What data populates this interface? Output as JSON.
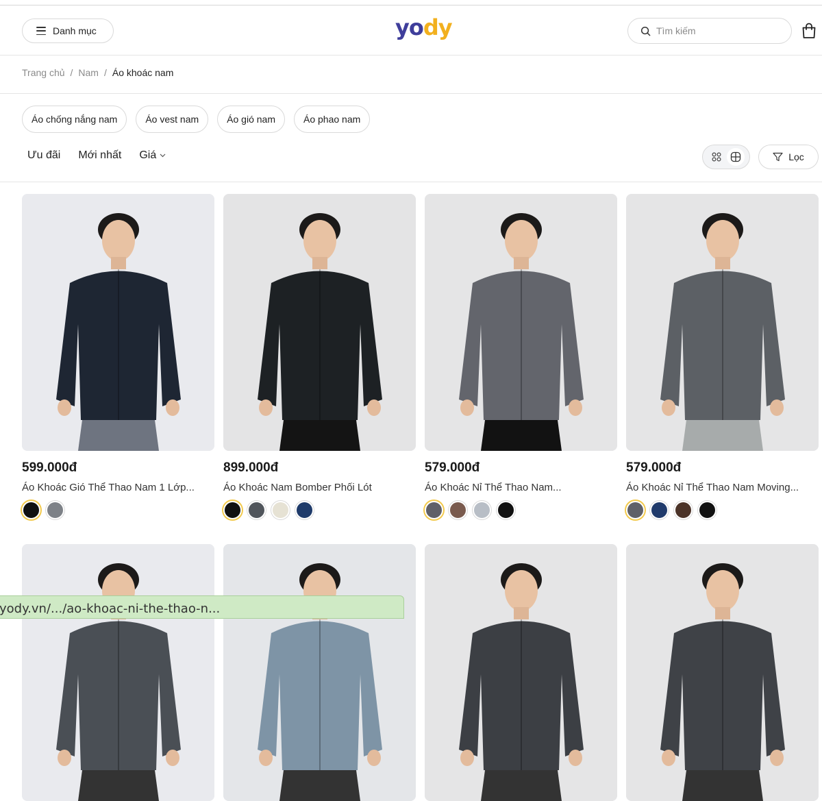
{
  "header": {
    "menu_label": "Danh mục",
    "logo_left": "yo",
    "logo_right": "dy",
    "search_placeholder": "Tìm kiếm"
  },
  "breadcrumb": {
    "home": "Trang chủ",
    "sep1": "/",
    "level2": "Nam",
    "sep2": "/",
    "current": "Áo khoác nam"
  },
  "chips": [
    "Áo chống nắng nam",
    "Áo vest nam",
    "Áo gió nam",
    "Áo phao nam"
  ],
  "sorts": {
    "promo": "Ưu đãi",
    "newest": "Mới nhất",
    "price": "Giá"
  },
  "filter_label": "Lọc",
  "products": [
    {
      "price": "599.000đ",
      "name": "Áo Khoác Gió Thể Thao Nam 1 Lớp...",
      "swatches": [
        "#111111",
        "#7d8187"
      ],
      "selected": 0,
      "jacket": "#1e2633",
      "pants": "#6e7480",
      "bg": "#e9eaee"
    },
    {
      "price": "899.000đ",
      "name": "Áo Khoác Nam Bomber Phối Lót",
      "swatches": [
        "#111111",
        "#50555b",
        "#e6e2d4",
        "#1f3b6a"
      ],
      "selected": 0,
      "jacket": "#1d2124",
      "pants": "#141414",
      "bg": "#e4e4e5"
    },
    {
      "price": "579.000đ",
      "name": "Áo Khoác Nỉ Thể Thao Nam...",
      "swatches": [
        "#5f6068",
        "#7a5b4e",
        "#b8bec6",
        "#111111"
      ],
      "selected": 0,
      "jacket": "#63656c",
      "pants": "#121212",
      "bg": "#e5e5e6"
    },
    {
      "price": "579.000đ",
      "name": "Áo Khoác Nỉ Thể Thao Nam Moving...",
      "swatches": [
        "#5f6068",
        "#203a6b",
        "#4b3328",
        "#111111"
      ],
      "selected": 0,
      "jacket": "#5c6065",
      "pants": "#a7abab",
      "bg": "#e5e5e6"
    }
  ],
  "products_row2": [
    {
      "jacket": "#4a4f55",
      "bg": "#e9eaee"
    },
    {
      "jacket": "#7e94a6",
      "bg": "#e4e6e9"
    },
    {
      "jacket": "#3c3f44",
      "bg": "#e5e5e6"
    },
    {
      "jacket": "#3f4247",
      "bg": "#e5e5e6"
    }
  ],
  "status_url": "yody.vn/.../ao-khoac-ni-the-thao-n..."
}
